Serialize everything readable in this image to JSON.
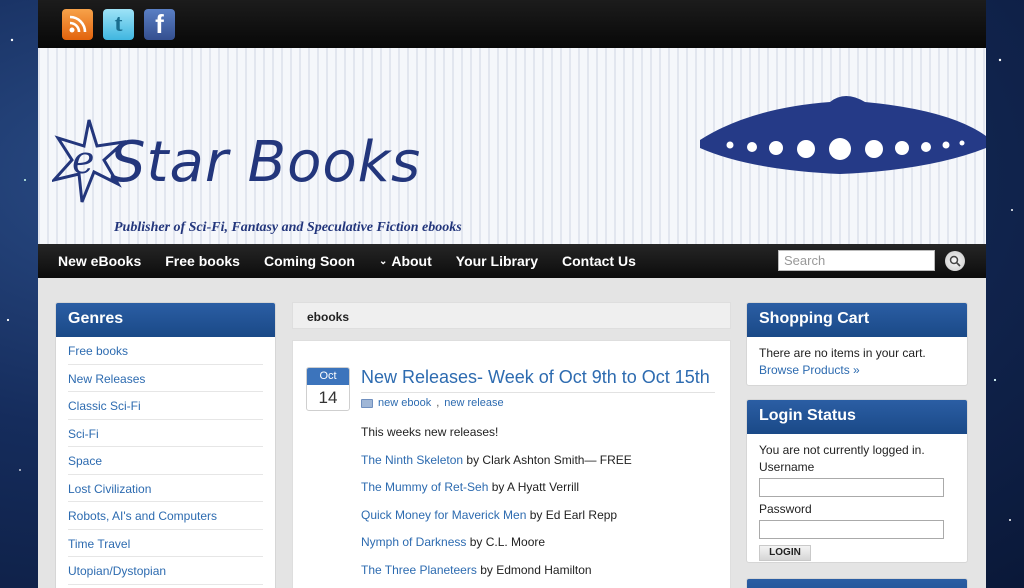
{
  "social": {
    "rss": "rss-icon",
    "twitter": "t",
    "facebook": "f"
  },
  "banner": {
    "logo_e": "e",
    "logo_text": "Star Books",
    "tagline": "Publisher of Sci-Fi, Fantasy and Speculative Fiction ebooks"
  },
  "nav": {
    "items": [
      "New eBooks",
      "Free books",
      "Coming Soon",
      "About",
      "Your Library",
      "Contact Us"
    ],
    "about_chevron": "⌄",
    "search_placeholder": "Search"
  },
  "genres": {
    "title": "Genres",
    "items": [
      "Free books",
      "New Releases",
      "Classic Sci-Fi",
      "Sci-Fi",
      "Space",
      "Lost Civilization",
      "Robots, AI's and Computers",
      "Time Travel",
      "Utopian/Dystopian"
    ]
  },
  "content": {
    "header": "ebooks",
    "post": {
      "month": "Oct",
      "day": "14",
      "title": "New Releases- Week of Oct 9th to Oct 15th",
      "tags": [
        "new ebook",
        "new release"
      ],
      "intro": "This weeks new releases!",
      "books": [
        {
          "title": "The Ninth Skeleton",
          "by": " by Clark Ashton Smith— FREE"
        },
        {
          "title": "The Mummy of Ret-Seh",
          "by": " by A Hyatt Verrill"
        },
        {
          "title": "Quick Money for Maverick Men",
          "by": " by Ed Earl Repp"
        },
        {
          "title": "Nymph of Darkness",
          "by": " by C.L. Moore"
        },
        {
          "title": "The Three Planeteers",
          "by": " by Edmond Hamilton"
        }
      ]
    }
  },
  "cart": {
    "title": "Shopping Cart",
    "empty_text": "There are no items in your cart.",
    "browse_link": "Browse Products »"
  },
  "login": {
    "title": "Login Status",
    "status_text": "You are not currently logged in.",
    "username_label": "Username",
    "password_label": "Password",
    "button": "LOGIN"
  },
  "colors": {
    "accent": "#1f4f95",
    "link": "#2d6bb0",
    "logo": "#23367c"
  }
}
